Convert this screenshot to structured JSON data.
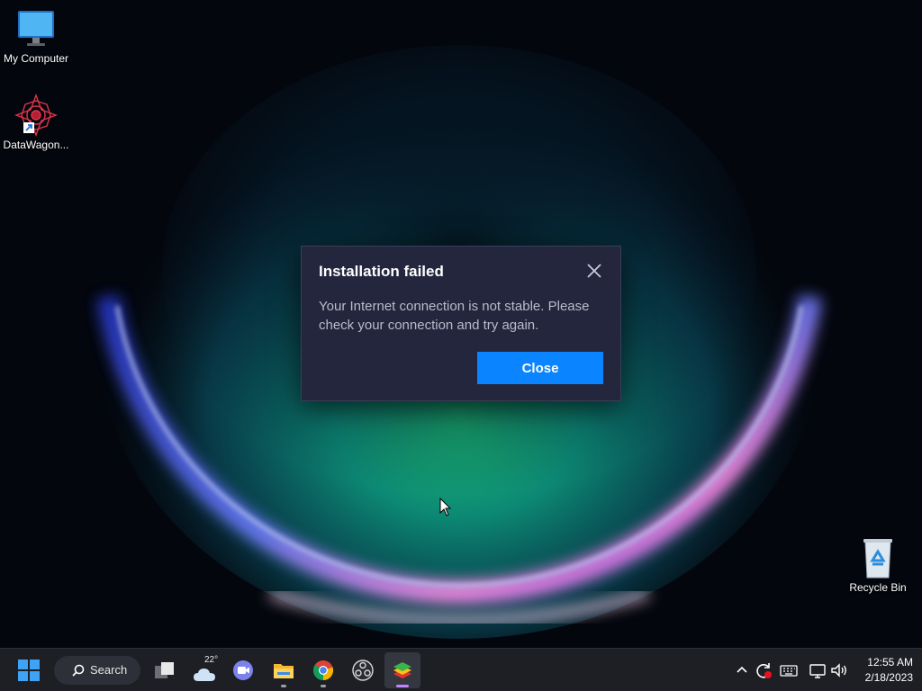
{
  "desktop": {
    "icons": [
      {
        "label": "My Computer"
      },
      {
        "label": "DataWagon..."
      },
      {
        "label": "Recycle Bin"
      }
    ]
  },
  "dialog": {
    "title": "Installation failed",
    "message": "Your Internet connection is not stable. Please check your connection and try again.",
    "close_button_label": "Close",
    "accent_color": "#0a84ff",
    "background_color": "#23263d"
  },
  "taskbar": {
    "search_label": "Search",
    "weather_temp": "22°",
    "pinned_apps": [
      "task-view",
      "weather",
      "chat",
      "file-explorer",
      "chrome",
      "obs-studio",
      "bluestacks"
    ]
  },
  "system_tray": {
    "time": "12:55 AM",
    "date": "2/18/2023"
  }
}
